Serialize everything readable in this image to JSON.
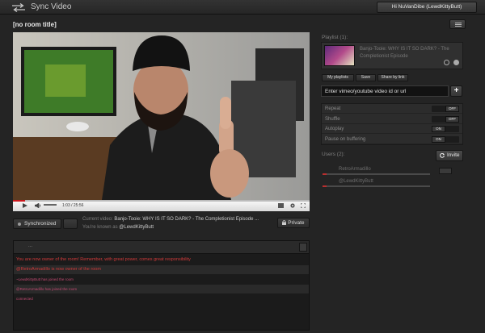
{
  "app": {
    "title": "Sync Video"
  },
  "header": {
    "greeting": "Hi NuVanDibe (LewdKittyButt)"
  },
  "room": {
    "title": "[no room title]"
  },
  "player": {
    "time": "1:03 / 25:56",
    "progress": 0.04
  },
  "controls": {
    "sync_label": "Synchronized",
    "private_label": "Private",
    "current_video_prefix": "Current video:",
    "current_video_title": "Banjo-Tooie: WHY IS IT SO DARK? - The Completionist Episode ...",
    "known_as_prefix": "You're known as",
    "known_as_name": "@LewdKittyButt"
  },
  "chat": {
    "tab_label": "...",
    "messages": [
      {
        "text": "You are now owner of the room! Remember, with great power, comes great responsibility",
        "style": "red"
      },
      {
        "text": "@RetroArmadillo is now owner of the room",
        "style": "red"
      },
      {
        "text": "~LewdKittyButt has joined the room",
        "style": "pink"
      },
      {
        "text": "@RetroArmadillo has joined the room",
        "style": "pink"
      },
      {
        "text": "connected",
        "style": "pink"
      }
    ]
  },
  "playlist": {
    "label": "Playlist (1):",
    "item_title": "Banjo-Tooie: WHY IS IT SO DARK? - The Completionist Episode",
    "buttons": {
      "my_playlists": "My playlists",
      "save": "Save",
      "share": "Share by link"
    },
    "input_placeholder": "Enter vimeo/youtube video id or url"
  },
  "options": [
    {
      "label": "Repeat",
      "state": "OFF"
    },
    {
      "label": "Shuffle",
      "state": "OFF"
    },
    {
      "label": "Autoplay",
      "state": "ON"
    },
    {
      "label": "Pause on buffering",
      "state": "ON"
    }
  ],
  "users": {
    "label": "Users (2):",
    "invite_label": "Invite",
    "list": [
      {
        "name": "RetroArmadillo",
        "progress": 0.04
      },
      {
        "name": "@LewdKittyButt",
        "progress": 0.04
      }
    ]
  }
}
